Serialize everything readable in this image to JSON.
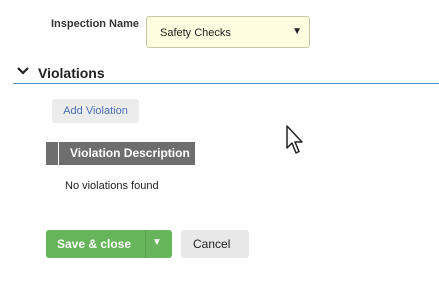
{
  "form": {
    "inspection_label": "Inspection Name",
    "inspection_value": "Safety Checks"
  },
  "violations": {
    "title": "Violations",
    "add_button": "Add Violation",
    "columns": [
      "Violation Description"
    ],
    "empty_message": "No violations found"
  },
  "actions": {
    "save_close": "Save & close",
    "cancel": "Cancel"
  },
  "icons": {
    "select_caret": "caret-down-icon",
    "section_toggle": "chevron-down-icon",
    "split_caret": "caret-down-icon",
    "pointer": "mouse-cursor-icon"
  },
  "colors": {
    "select_bg": "#fdfde0",
    "section_rule": "#5a8fc2",
    "table_header": "#6e6e6e",
    "primary": "#67b55a",
    "link": "#4a6fb5"
  }
}
